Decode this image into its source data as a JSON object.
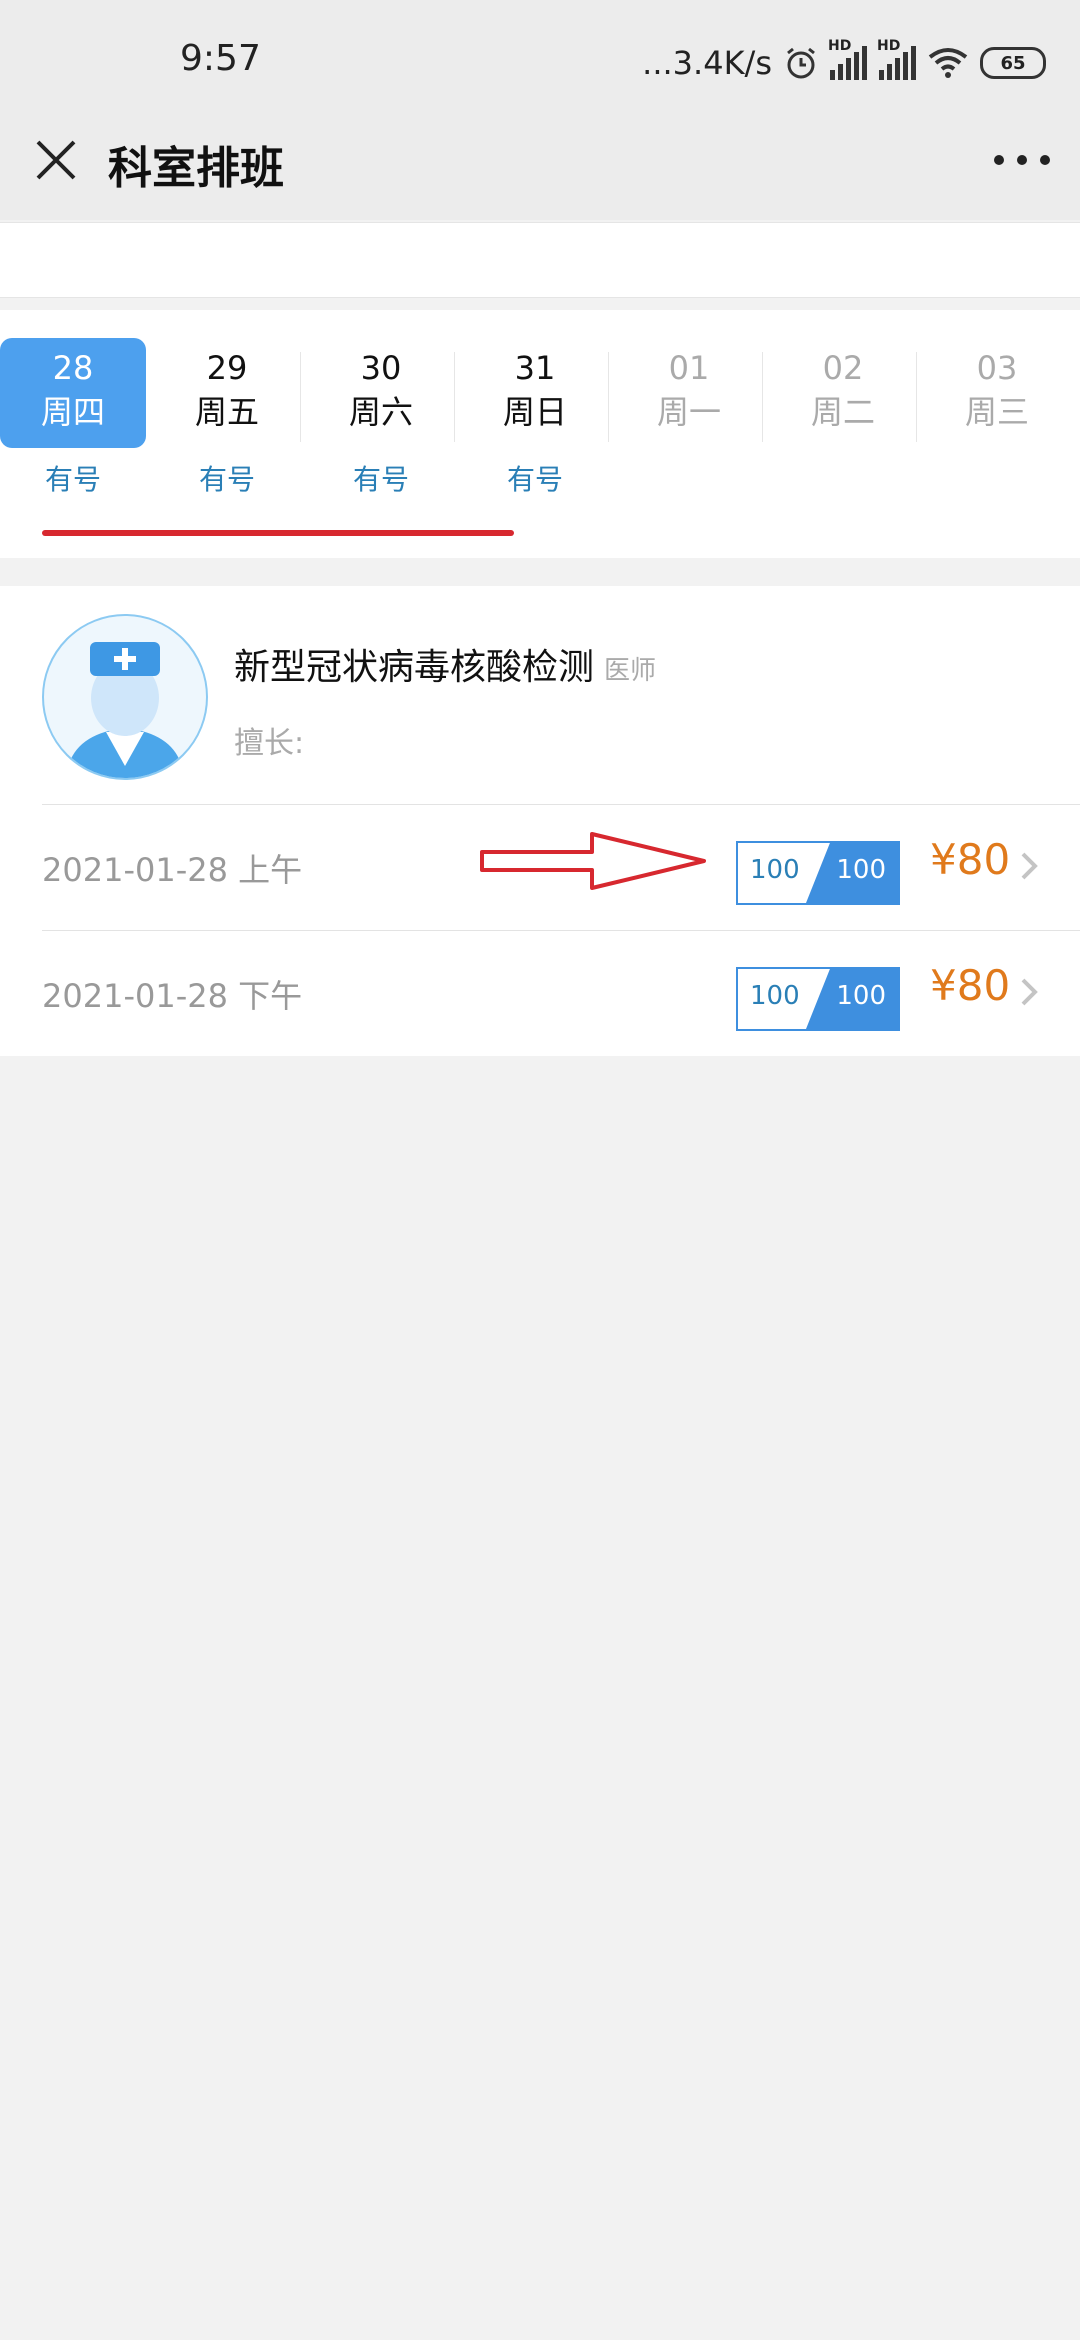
{
  "status_bar": {
    "time": "9:57",
    "speed": "...3.4K/s",
    "hd_label": "HD",
    "battery": "65"
  },
  "nav": {
    "title": "科室排班"
  },
  "dates": [
    {
      "num": "28",
      "weekday": "周四",
      "avail": "有号",
      "state": "active"
    },
    {
      "num": "29",
      "weekday": "周五",
      "avail": "有号",
      "state": "normal"
    },
    {
      "num": "30",
      "weekday": "周六",
      "avail": "有号",
      "state": "normal"
    },
    {
      "num": "31",
      "weekday": "周日",
      "avail": "有号",
      "state": "normal"
    },
    {
      "num": "01",
      "weekday": "周一",
      "avail": "",
      "state": "dim"
    },
    {
      "num": "02",
      "weekday": "周二",
      "avail": "",
      "state": "dim"
    },
    {
      "num": "03",
      "weekday": "周三",
      "avail": "",
      "state": "dim"
    }
  ],
  "doctor": {
    "name": "新型冠状病毒核酸检测",
    "title": "医师",
    "skill_label": "擅长:"
  },
  "slots": [
    {
      "date": "2021-01-28 上午",
      "quota_total": "100",
      "quota_left": "100",
      "price": "¥80"
    },
    {
      "date": "2021-01-28 下午",
      "quota_total": "100",
      "quota_left": "100",
      "price": "¥80"
    }
  ],
  "colors": {
    "accent": "#4da0ee",
    "price": "#e07a1c",
    "annotation": "#d7282f"
  }
}
